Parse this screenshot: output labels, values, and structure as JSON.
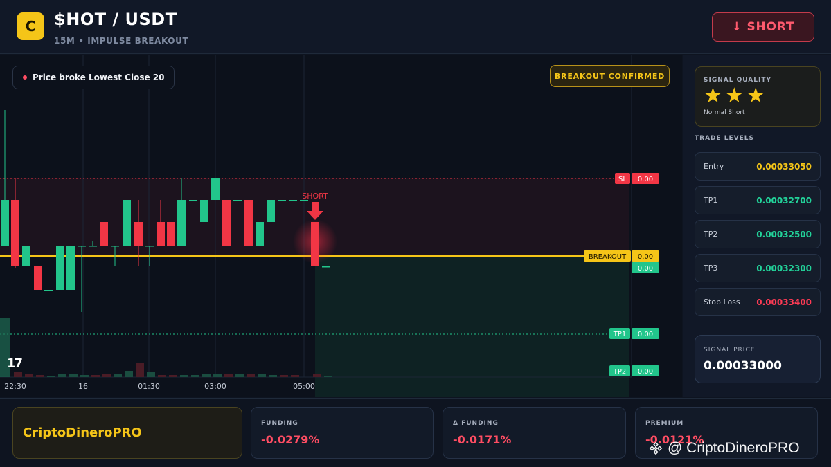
{
  "header": {
    "logo_letter": "C",
    "pair": "$HOT / USDT",
    "subtitle": "15M • IMPULSE BREAKOUT",
    "short_button": "↓ SHORT"
  },
  "chart": {
    "price_pill": "Price broke Lowest Close 20",
    "breakout_badge": "BREAKOUT CONFIRMED",
    "short_marker": "SHORT",
    "tv_logo": "17",
    "time_labels": [
      "22:30",
      "16",
      "01:30",
      "03:00",
      "05:00"
    ],
    "level_tags": [
      {
        "name": "SL",
        "value": "0.00",
        "color": "#f23645"
      },
      {
        "name": "BREAKOUT",
        "value": "0.00",
        "color": "#f5c518"
      },
      {
        "name": "",
        "value": "0.00",
        "color": "#22c58b"
      },
      {
        "name": "TP1",
        "value": "0.00",
        "color": "#22c58b"
      },
      {
        "name": "TP2",
        "value": "0.00",
        "color": "#22c58b"
      }
    ],
    "colors": {
      "up": "#22c58b",
      "down": "#f23645",
      "breakout": "#f5c518"
    }
  },
  "side": {
    "quality_title": "SIGNAL QUALITY",
    "stars": "★★★",
    "star_count": 3,
    "quality_label": "Normal Short",
    "levels_title": "TRADE LEVELS",
    "levels": [
      {
        "label": "Entry",
        "value": "0.00033050",
        "color": "#f5c518"
      },
      {
        "label": "TP1",
        "value": "0.00032700",
        "color": "#22d39a"
      },
      {
        "label": "TP2",
        "value": "0.00032500",
        "color": "#22d39a"
      },
      {
        "label": "TP3",
        "value": "0.00032300",
        "color": "#22d39a"
      },
      {
        "label": "Stop Loss",
        "value": "0.00033400",
        "color": "#ff3b55"
      }
    ],
    "signal_price_label": "SIGNAL PRICE",
    "signal_price": "0.00033000"
  },
  "footer": {
    "brand": "CriptoDineroPRO",
    "stats": [
      {
        "label": "FUNDING",
        "value": "-0.0279%"
      },
      {
        "label": "Δ FUNDING",
        "value": "-0.0171%"
      },
      {
        "label": "PREMIUM",
        "value": "-0.0121%"
      }
    ],
    "watermark": "@ CriptoDineroPRO"
  }
}
